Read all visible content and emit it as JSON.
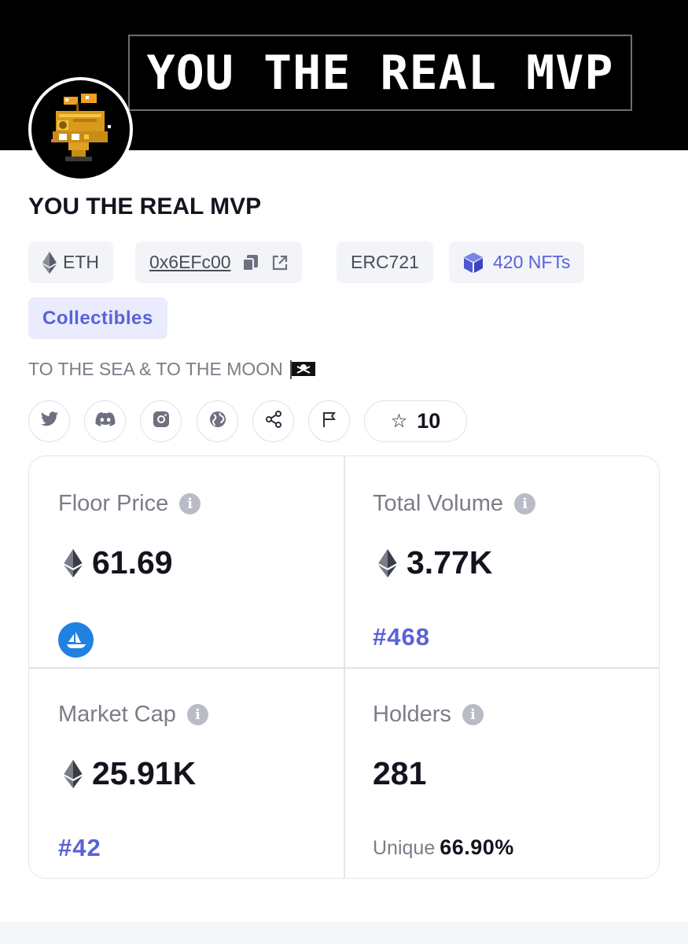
{
  "banner": {
    "text": "YOU THE REAL MVP"
  },
  "collection": {
    "title": "YOU THE REAL MVP",
    "chain": "ETH",
    "address": "0x6EFc00",
    "standard": "ERC721",
    "nft_count": "420 NFTs",
    "category": "Collectibles",
    "description": "TO THE SEA & TO THE MOON"
  },
  "socials": {
    "icons": [
      "twitter-icon",
      "discord-icon",
      "instagram-icon",
      "website-icon",
      "share-icon",
      "report-flag-icon"
    ],
    "star_count": "10"
  },
  "stats": {
    "floor_price": {
      "label": "Floor Price",
      "value": "61.69"
    },
    "total_volume": {
      "label": "Total Volume",
      "value": "3.77K",
      "rank": "#468"
    },
    "market_cap": {
      "label": "Market Cap",
      "value": "25.91K",
      "rank": "#42"
    },
    "holders": {
      "label": "Holders",
      "value": "281",
      "unique_label": "Unique",
      "unique_value": "66.90%"
    }
  },
  "colors": {
    "accent": "#5862d8",
    "opensea": "#2081e2",
    "banner_bg": "#000000"
  }
}
